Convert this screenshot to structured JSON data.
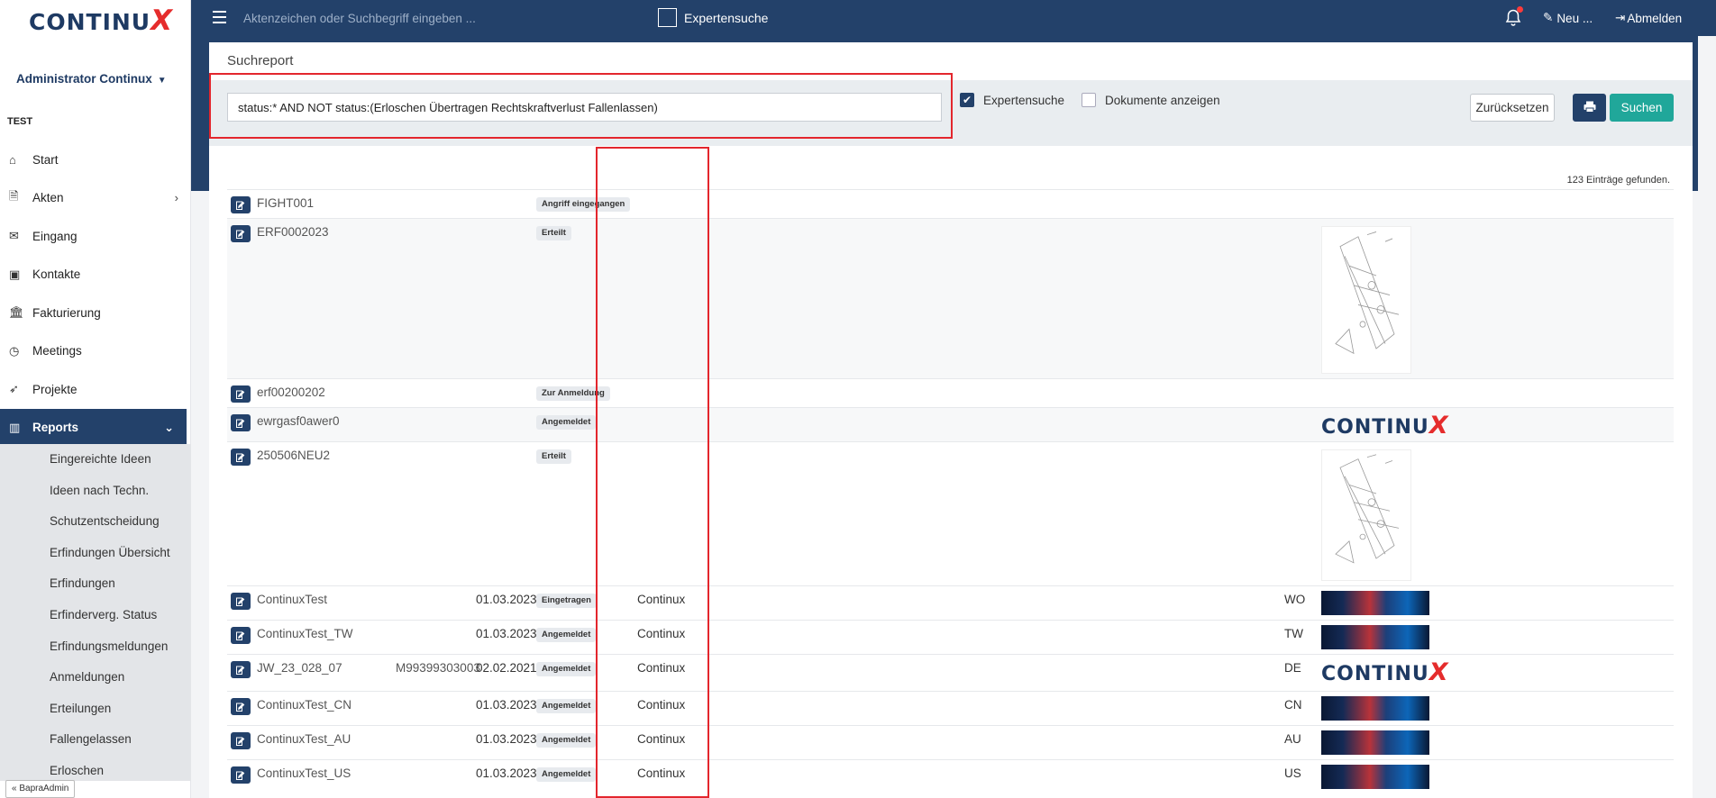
{
  "sidebar": {
    "logo": {
      "text": "CONTINU",
      "accent": "X"
    },
    "user": "Administrator Continux",
    "section": "TEST",
    "items": [
      {
        "label": "Start",
        "icon": "home-icon"
      },
      {
        "label": "Akten",
        "icon": "file-icon"
      },
      {
        "label": "Eingang",
        "icon": "envelope-icon"
      },
      {
        "label": "Kontakte",
        "icon": "contact-icon"
      },
      {
        "label": "Fakturierung",
        "icon": "bank-icon"
      },
      {
        "label": "Meetings",
        "icon": "clock-icon"
      },
      {
        "label": "Projekte",
        "icon": "rocket-icon"
      },
      {
        "label": "Reports",
        "icon": "bar-chart-icon"
      }
    ],
    "subitems": [
      "Eingereichte Ideen",
      "Ideen nach Techn.",
      "Schutzentscheidung",
      "Erfindungen Übersicht",
      "Erfindungen",
      "Erfinderverg. Status",
      "Erfindungsmeldungen",
      "Anmeldungen",
      "Erteilungen",
      "Fallengelassen",
      "Erloschen"
    ],
    "bottom_tag": "BapraAdmin"
  },
  "topbar": {
    "search_placeholder": "Aktenzeichen oder Suchbegriff eingeben ...",
    "expert_label": "Expertensuche",
    "new_label": "Neu ...",
    "logout_label": "Abmelden"
  },
  "report": {
    "title": "Suchreport",
    "query": "status:* AND NOT status:(Erloschen Übertragen Rechtskraftverlust Fallenlassen)",
    "expert_label": "Expertensuche",
    "documents_label": "Dokumente anzeigen",
    "reset_label": "Zurücksetzen",
    "search_label": "Suchen",
    "count_text": "123 Einträge gefunden."
  },
  "results": [
    {
      "id": "FIGHT001",
      "ref": "",
      "date": "",
      "status": "Angriff eingegangen",
      "owner": "",
      "country": "",
      "thumb": "none"
    },
    {
      "id": "ERF0002023",
      "ref": "",
      "date": "",
      "status": "Erteilt",
      "owner": "",
      "country": "",
      "thumb": "drawing"
    },
    {
      "id": "erf00200202",
      "ref": "",
      "date": "",
      "status": "Zur Anmeldung",
      "owner": "",
      "country": "",
      "thumb": "none"
    },
    {
      "id": "ewrgasf0awer0",
      "ref": "",
      "date": "",
      "status": "Angemeldet",
      "owner": "",
      "country": "",
      "thumb": "logo"
    },
    {
      "id": "250506NEU2",
      "ref": "",
      "date": "",
      "status": "Erteilt",
      "owner": "",
      "country": "",
      "thumb": "drawing"
    },
    {
      "id": "ContinuxTest",
      "ref": "",
      "date": "01.03.2023",
      "status": "Eingetragen",
      "owner": "Continux",
      "country": "WO",
      "thumb": "galaxy"
    },
    {
      "id": "ContinuxTest_TW",
      "ref": "",
      "date": "01.03.2023",
      "status": "Angemeldet",
      "owner": "Continux",
      "country": "TW",
      "thumb": "galaxy"
    },
    {
      "id": "JW_23_028_07",
      "ref": "M99399303003",
      "date": "02.02.2021",
      "status": "Angemeldet",
      "owner": "Continux",
      "country": "DE",
      "thumb": "logo"
    },
    {
      "id": "ContinuxTest_CN",
      "ref": "",
      "date": "01.03.2023",
      "status": "Angemeldet",
      "owner": "Continux",
      "country": "CN",
      "thumb": "galaxy"
    },
    {
      "id": "ContinuxTest_AU",
      "ref": "",
      "date": "01.03.2023",
      "status": "Angemeldet",
      "owner": "Continux",
      "country": "AU",
      "thumb": "galaxy"
    },
    {
      "id": "ContinuxTest_US",
      "ref": "",
      "date": "01.03.2023",
      "status": "Angemeldet",
      "owner": "Continux",
      "country": "US",
      "thumb": "galaxy"
    }
  ],
  "colors": {
    "navy": "#23416a",
    "teal": "#20a79a",
    "annotation_red": "#e3262d",
    "logo_red": "#e52c2c"
  }
}
